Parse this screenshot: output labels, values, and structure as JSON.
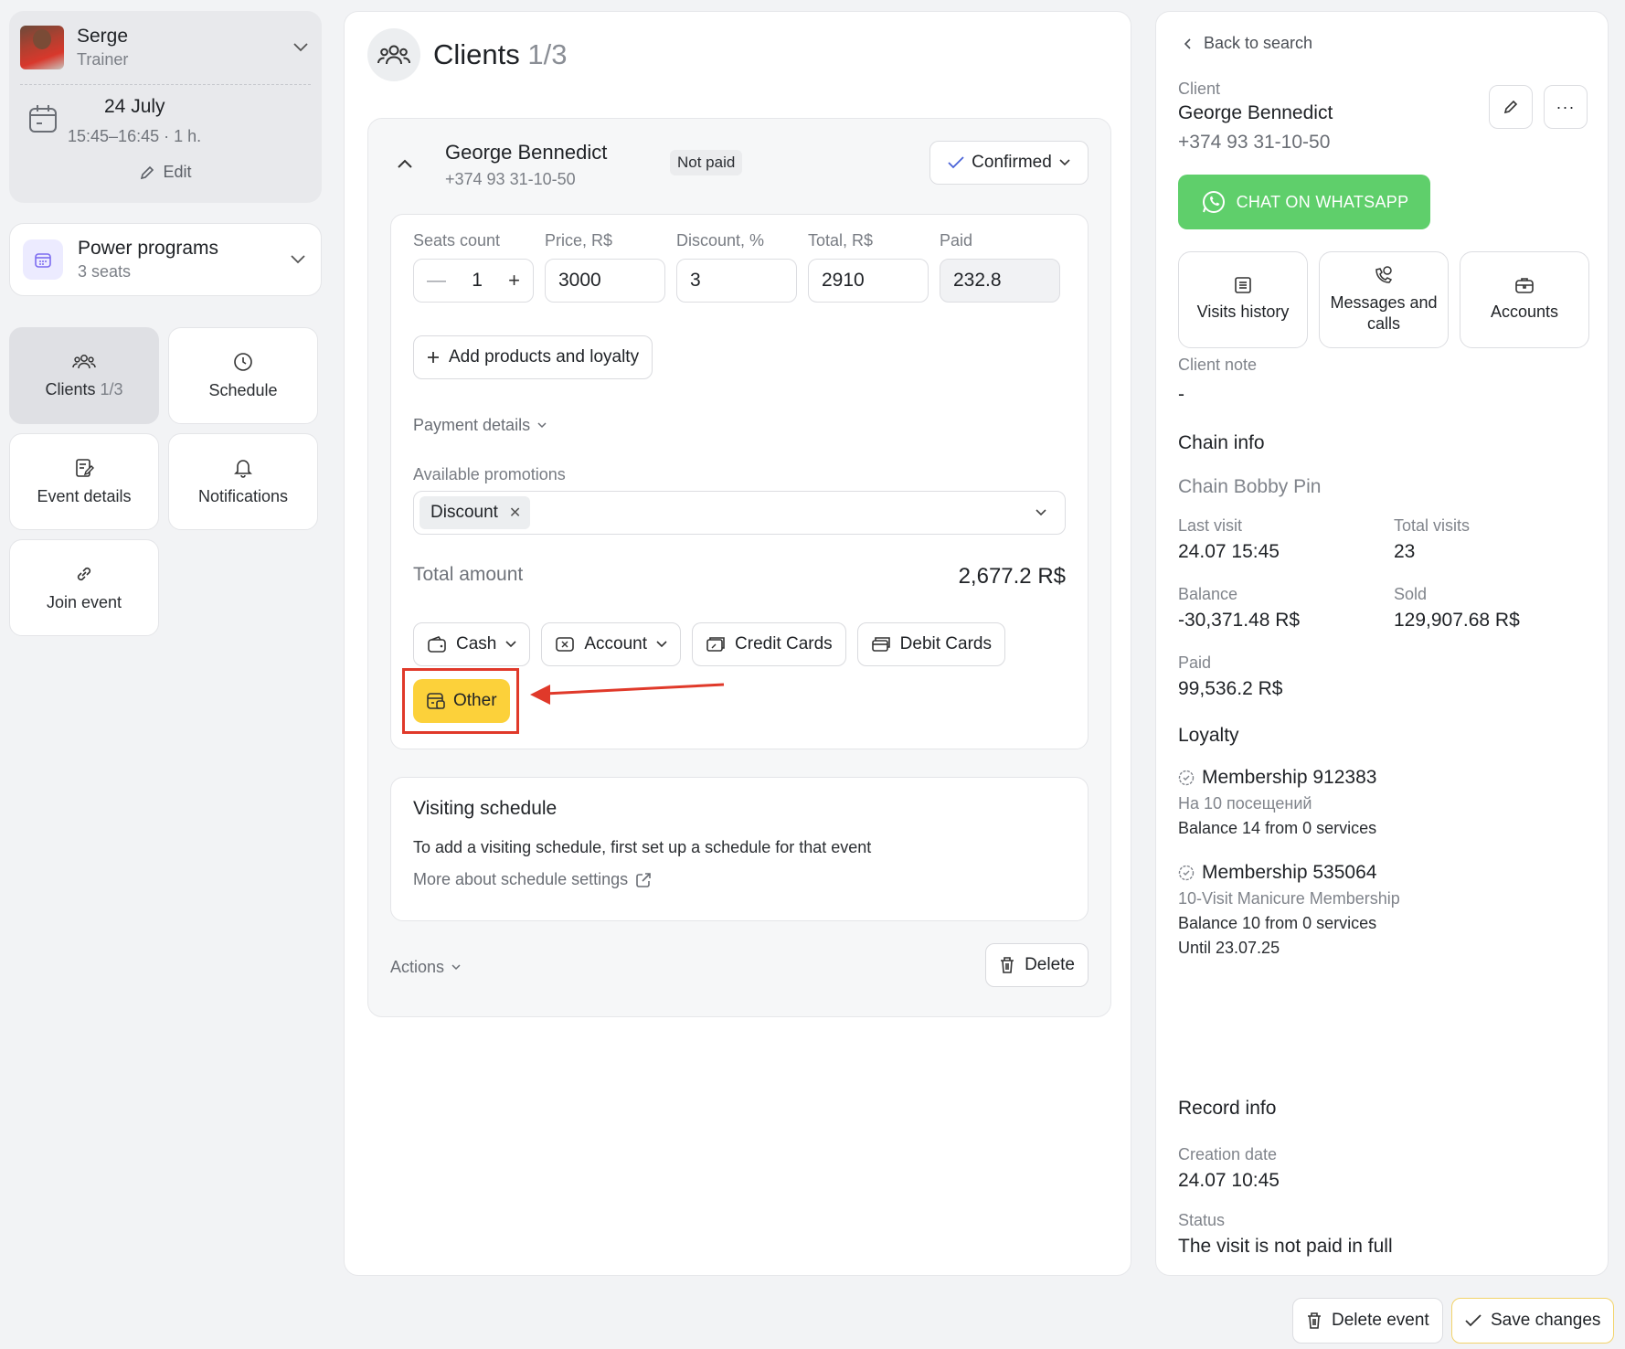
{
  "trainer": {
    "name": "Serge",
    "role": "Trainer"
  },
  "event": {
    "date": "24 July",
    "time": "15:45–16:45 · 1 h.",
    "edit_label": "Edit"
  },
  "program": {
    "name": "Power programs",
    "seats": "3 seats"
  },
  "nav": {
    "clients_label": "Clients",
    "clients_count": "1/3",
    "schedule": "Schedule",
    "event_details": "Event details",
    "notifications": "Notifications",
    "join_event": "Join event"
  },
  "header": {
    "title": "Clients",
    "count": "1/3"
  },
  "client": {
    "name": "George Bennedict",
    "phone": "+374 93 31-10-50",
    "payment_badge": "Not paid",
    "status": "Confirmed"
  },
  "pricing": {
    "seats_label": "Seats count",
    "seats_value": "1",
    "price_label": "Price, R$",
    "price_value": "3000",
    "discount_label": "Discount, %",
    "discount_value": "3",
    "total_label": "Total, R$",
    "total_value": "2910",
    "paid_label": "Paid",
    "paid_value": "232.8"
  },
  "add_products_label": "Add products and loyalty",
  "payment_details_label": "Payment details",
  "promotions": {
    "label": "Available promotions",
    "chip": "Discount"
  },
  "total_amount": {
    "label": "Total amount",
    "value": "2,677.2 R$"
  },
  "payment_methods": {
    "cash": "Cash",
    "account": "Account",
    "credit": "Credit Cards",
    "debit": "Debit Cards",
    "other": "Other"
  },
  "visiting_schedule": {
    "title": "Visiting schedule",
    "text": "To add a visiting schedule, first set up a schedule for that event",
    "link": "More about schedule settings"
  },
  "actions_label": "Actions",
  "delete_label": "Delete",
  "right": {
    "back": "Back to search",
    "client_label": "Client",
    "client_name": "George Bennedict",
    "client_phone": "+374 93 31-10-50",
    "whatsapp": "CHAT ON WHATSAPP",
    "tiles": {
      "visits": "Visits history",
      "messages": "Messages and calls",
      "accounts": "Accounts"
    },
    "note_label": "Client note",
    "note_value": "-",
    "chain_title": "Chain info",
    "chain_name": "Chain Bobby Pin",
    "last_visit_label": "Last visit",
    "last_visit": "24.07 15:45",
    "total_visits_label": "Total visits",
    "total_visits": "23",
    "balance_label": "Balance",
    "balance": "-30,371.48 R$",
    "sold_label": "Sold",
    "sold": "129,907.68 R$",
    "paid_label": "Paid",
    "paid": "99,536.2 R$",
    "loyalty_title": "Loyalty",
    "memberships": [
      {
        "title": "Membership 912383",
        "sub": "На 10 посещений",
        "balance": "Balance 14 from 0 services"
      },
      {
        "title": "Membership 535064",
        "sub": "10-Visit Manicure Membership",
        "balance": "Balance 10 from 0 services",
        "until": "Until 23.07.25"
      }
    ],
    "record_title": "Record info",
    "creation_label": "Creation date",
    "creation": "24.07 10:45",
    "status_label": "Status",
    "status": "The visit is not paid in full"
  },
  "footer": {
    "delete_event": "Delete event",
    "save": "Save changes"
  },
  "colors": {
    "accent_yellow": "#fcd13a",
    "whatsapp_green": "#5fcf6b",
    "highlight_red": "#e0392a",
    "program_purple": "#7c6cf0"
  }
}
